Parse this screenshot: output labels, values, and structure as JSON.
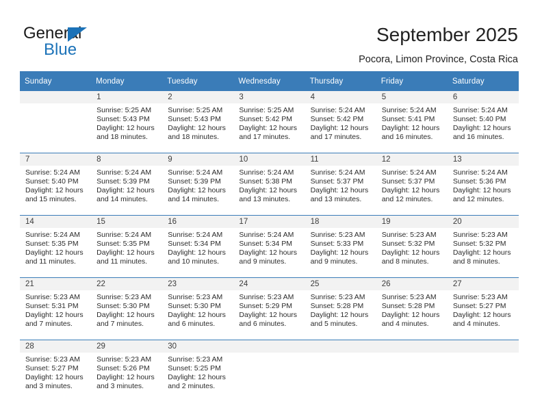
{
  "brand": {
    "name_top": "General",
    "name_bottom": "Blue",
    "triangle_icon": "blue-triangle-icon",
    "accent_color": "#1b72b8"
  },
  "header": {
    "title": "September 2025",
    "subtitle": "Pocora, Limon Province, Costa Rica"
  },
  "calendar": {
    "header_bg": "#3a7cb8",
    "daynum_band_bg": "#f2f2f2",
    "separator_color": "#3a7cb8",
    "weekdays": [
      "Sunday",
      "Monday",
      "Tuesday",
      "Wednesday",
      "Thursday",
      "Friday",
      "Saturday"
    ],
    "weeks": [
      [
        {
          "day": "",
          "sunrise": "",
          "sunset": "",
          "daylight_line1": "",
          "daylight_line2": ""
        },
        {
          "day": "1",
          "sunrise": "Sunrise: 5:25 AM",
          "sunset": "Sunset: 5:43 PM",
          "daylight_line1": "Daylight: 12 hours",
          "daylight_line2": "and 18 minutes."
        },
        {
          "day": "2",
          "sunrise": "Sunrise: 5:25 AM",
          "sunset": "Sunset: 5:43 PM",
          "daylight_line1": "Daylight: 12 hours",
          "daylight_line2": "and 18 minutes."
        },
        {
          "day": "3",
          "sunrise": "Sunrise: 5:25 AM",
          "sunset": "Sunset: 5:42 PM",
          "daylight_line1": "Daylight: 12 hours",
          "daylight_line2": "and 17 minutes."
        },
        {
          "day": "4",
          "sunrise": "Sunrise: 5:24 AM",
          "sunset": "Sunset: 5:42 PM",
          "daylight_line1": "Daylight: 12 hours",
          "daylight_line2": "and 17 minutes."
        },
        {
          "day": "5",
          "sunrise": "Sunrise: 5:24 AM",
          "sunset": "Sunset: 5:41 PM",
          "daylight_line1": "Daylight: 12 hours",
          "daylight_line2": "and 16 minutes."
        },
        {
          "day": "6",
          "sunrise": "Sunrise: 5:24 AM",
          "sunset": "Sunset: 5:40 PM",
          "daylight_line1": "Daylight: 12 hours",
          "daylight_line2": "and 16 minutes."
        }
      ],
      [
        {
          "day": "7",
          "sunrise": "Sunrise: 5:24 AM",
          "sunset": "Sunset: 5:40 PM",
          "daylight_line1": "Daylight: 12 hours",
          "daylight_line2": "and 15 minutes."
        },
        {
          "day": "8",
          "sunrise": "Sunrise: 5:24 AM",
          "sunset": "Sunset: 5:39 PM",
          "daylight_line1": "Daylight: 12 hours",
          "daylight_line2": "and 14 minutes."
        },
        {
          "day": "9",
          "sunrise": "Sunrise: 5:24 AM",
          "sunset": "Sunset: 5:39 PM",
          "daylight_line1": "Daylight: 12 hours",
          "daylight_line2": "and 14 minutes."
        },
        {
          "day": "10",
          "sunrise": "Sunrise: 5:24 AM",
          "sunset": "Sunset: 5:38 PM",
          "daylight_line1": "Daylight: 12 hours",
          "daylight_line2": "and 13 minutes."
        },
        {
          "day": "11",
          "sunrise": "Sunrise: 5:24 AM",
          "sunset": "Sunset: 5:37 PM",
          "daylight_line1": "Daylight: 12 hours",
          "daylight_line2": "and 13 minutes."
        },
        {
          "day": "12",
          "sunrise": "Sunrise: 5:24 AM",
          "sunset": "Sunset: 5:37 PM",
          "daylight_line1": "Daylight: 12 hours",
          "daylight_line2": "and 12 minutes."
        },
        {
          "day": "13",
          "sunrise": "Sunrise: 5:24 AM",
          "sunset": "Sunset: 5:36 PM",
          "daylight_line1": "Daylight: 12 hours",
          "daylight_line2": "and 12 minutes."
        }
      ],
      [
        {
          "day": "14",
          "sunrise": "Sunrise: 5:24 AM",
          "sunset": "Sunset: 5:35 PM",
          "daylight_line1": "Daylight: 12 hours",
          "daylight_line2": "and 11 minutes."
        },
        {
          "day": "15",
          "sunrise": "Sunrise: 5:24 AM",
          "sunset": "Sunset: 5:35 PM",
          "daylight_line1": "Daylight: 12 hours",
          "daylight_line2": "and 11 minutes."
        },
        {
          "day": "16",
          "sunrise": "Sunrise: 5:24 AM",
          "sunset": "Sunset: 5:34 PM",
          "daylight_line1": "Daylight: 12 hours",
          "daylight_line2": "and 10 minutes."
        },
        {
          "day": "17",
          "sunrise": "Sunrise: 5:24 AM",
          "sunset": "Sunset: 5:34 PM",
          "daylight_line1": "Daylight: 12 hours",
          "daylight_line2": "and 9 minutes."
        },
        {
          "day": "18",
          "sunrise": "Sunrise: 5:23 AM",
          "sunset": "Sunset: 5:33 PM",
          "daylight_line1": "Daylight: 12 hours",
          "daylight_line2": "and 9 minutes."
        },
        {
          "day": "19",
          "sunrise": "Sunrise: 5:23 AM",
          "sunset": "Sunset: 5:32 PM",
          "daylight_line1": "Daylight: 12 hours",
          "daylight_line2": "and 8 minutes."
        },
        {
          "day": "20",
          "sunrise": "Sunrise: 5:23 AM",
          "sunset": "Sunset: 5:32 PM",
          "daylight_line1": "Daylight: 12 hours",
          "daylight_line2": "and 8 minutes."
        }
      ],
      [
        {
          "day": "21",
          "sunrise": "Sunrise: 5:23 AM",
          "sunset": "Sunset: 5:31 PM",
          "daylight_line1": "Daylight: 12 hours",
          "daylight_line2": "and 7 minutes."
        },
        {
          "day": "22",
          "sunrise": "Sunrise: 5:23 AM",
          "sunset": "Sunset: 5:30 PM",
          "daylight_line1": "Daylight: 12 hours",
          "daylight_line2": "and 7 minutes."
        },
        {
          "day": "23",
          "sunrise": "Sunrise: 5:23 AM",
          "sunset": "Sunset: 5:30 PM",
          "daylight_line1": "Daylight: 12 hours",
          "daylight_line2": "and 6 minutes."
        },
        {
          "day": "24",
          "sunrise": "Sunrise: 5:23 AM",
          "sunset": "Sunset: 5:29 PM",
          "daylight_line1": "Daylight: 12 hours",
          "daylight_line2": "and 6 minutes."
        },
        {
          "day": "25",
          "sunrise": "Sunrise: 5:23 AM",
          "sunset": "Sunset: 5:28 PM",
          "daylight_line1": "Daylight: 12 hours",
          "daylight_line2": "and 5 minutes."
        },
        {
          "day": "26",
          "sunrise": "Sunrise: 5:23 AM",
          "sunset": "Sunset: 5:28 PM",
          "daylight_line1": "Daylight: 12 hours",
          "daylight_line2": "and 4 minutes."
        },
        {
          "day": "27",
          "sunrise": "Sunrise: 5:23 AM",
          "sunset": "Sunset: 5:27 PM",
          "daylight_line1": "Daylight: 12 hours",
          "daylight_line2": "and 4 minutes."
        }
      ],
      [
        {
          "day": "28",
          "sunrise": "Sunrise: 5:23 AM",
          "sunset": "Sunset: 5:27 PM",
          "daylight_line1": "Daylight: 12 hours",
          "daylight_line2": "and 3 minutes."
        },
        {
          "day": "29",
          "sunrise": "Sunrise: 5:23 AM",
          "sunset": "Sunset: 5:26 PM",
          "daylight_line1": "Daylight: 12 hours",
          "daylight_line2": "and 3 minutes."
        },
        {
          "day": "30",
          "sunrise": "Sunrise: 5:23 AM",
          "sunset": "Sunset: 5:25 PM",
          "daylight_line1": "Daylight: 12 hours",
          "daylight_line2": "and 2 minutes."
        },
        {
          "day": "",
          "sunrise": "",
          "sunset": "",
          "daylight_line1": "",
          "daylight_line2": ""
        },
        {
          "day": "",
          "sunrise": "",
          "sunset": "",
          "daylight_line1": "",
          "daylight_line2": ""
        },
        {
          "day": "",
          "sunrise": "",
          "sunset": "",
          "daylight_line1": "",
          "daylight_line2": ""
        },
        {
          "day": "",
          "sunrise": "",
          "sunset": "",
          "daylight_line1": "",
          "daylight_line2": ""
        }
      ]
    ]
  }
}
